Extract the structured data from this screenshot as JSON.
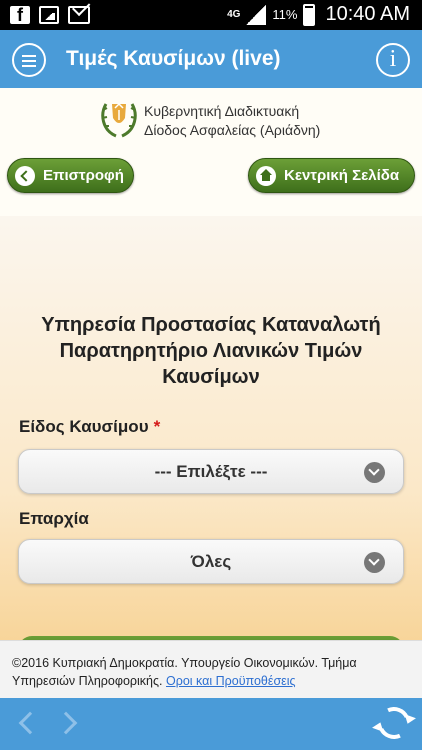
{
  "status_bar": {
    "icons": [
      "facebook-icon",
      "gallery-icon",
      "mail-icon",
      "signal-icon",
      "battery-icon"
    ],
    "network": "4G",
    "battery": "11%",
    "time": "10:40 AM"
  },
  "app_bar": {
    "title": "Τιμές Καυσίμων (live)",
    "menu_icon": "hamburger-menu-icon",
    "info_icon": "info-icon",
    "color": "#4a9bd8"
  },
  "header": {
    "logo_line1": "Κυβερνητική Διαδικτυακή",
    "logo_line2": "Δίοδος Ασφαλείας  (Αριάδνη)",
    "back_label": "Επιστροφή",
    "home_label": "Κεντρική Σελίδα",
    "button_color": "#4f8628"
  },
  "main": {
    "title_line1": "Υπηρεσία Προστασίας Καταναλωτή",
    "title_line2": "Παρατηρητήριο Λιανικών Τιμών",
    "title_line3": "Καυσίμων",
    "fuel_label": "Είδος Καυσίμου",
    "required_mark": "*",
    "fuel_select_value": "--- Επιλέξτε ---",
    "district_label": "Επαρχία",
    "district_select_value": "Όλες"
  },
  "footer": {
    "text": "©2016 Κυπριακή Δημοκρατία. Υπουργείο Οικονομικών. Τμήμα Υπηρεσιών Πληροφορικής.",
    "terms_link": "Οροι και Προϋποθέσεις"
  },
  "bottom_bar": {
    "icons": [
      "back-arrow-icon",
      "forward-arrow-icon",
      "refresh-icon"
    ]
  }
}
